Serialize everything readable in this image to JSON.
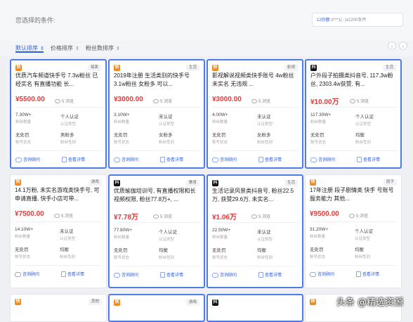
{
  "topbar": {
    "label": "您选择的条件:",
    "right_text_prefix": "12份额",
    "right_text": "d***1(··)x2200条件"
  },
  "sort": [
    {
      "label": "默认排序",
      "arrow": "⇕",
      "active": true
    },
    {
      "label": "价格排序",
      "arrow": "⇕",
      "active": false
    },
    {
      "label": "粉丝数排序",
      "arrow": "⇕",
      "active": false
    }
  ],
  "pager": {
    "prev": "‹",
    "next": "›"
  },
  "cards": [
    {
      "platform": "快",
      "tag": "搞笑",
      "title": "优质汽车频道快手号 7.3w粉丝 已经实名 有直播功能 长...",
      "price": "¥5500.00",
      "views": "5 浏览",
      "stats": [
        {
          "v": "7.30W+",
          "s": "粉丝数量"
        },
        {
          "v": "个人认证",
          "s": "认证类型"
        },
        {
          "v": "无处罚",
          "s": "账号状态"
        },
        {
          "v": "男粉多",
          "s": "粉丝性别"
        }
      ],
      "btn1": "咨询顾问",
      "btn2": "查看详情",
      "selected": true
    },
    {
      "platform": "快",
      "tag": "生活",
      "title": "2019年注册 生活类别的快手号 3.1w粉丝 女粉多 可以...",
      "price": "¥3000.00",
      "views": "5 浏览",
      "stats": [
        {
          "v": "3.10W+",
          "s": "粉丝数量"
        },
        {
          "v": "未认证",
          "s": "认证类型"
        },
        {
          "v": "无处罚",
          "s": "账号状态"
        },
        {
          "v": "女粉多",
          "s": "粉丝性别"
        }
      ],
      "btn1": "咨询顾问",
      "btn2": "查看详情",
      "selected": true
    },
    {
      "platform": "快",
      "tag": "影视",
      "title": "影视解说视频类快手账号 4w粉丝 未实名 无违规 ...",
      "price": "¥3000.00",
      "views": "5 浏览",
      "stats": [
        {
          "v": "4.00W+",
          "s": "粉丝数量"
        },
        {
          "v": "未认证",
          "s": "认证类型"
        },
        {
          "v": "无处罚",
          "s": "账号状态"
        },
        {
          "v": "女粉多",
          "s": "粉丝性别"
        }
      ],
      "btn1": "咨询顾问",
      "btn2": "查看详情",
      "selected": true
    },
    {
      "platform": "抖",
      "tag": "生活",
      "title": "户外段子拍摄类抖音号, 117.3w粉丝, 2303.4w获赞, 有...",
      "price": "¥10.00万",
      "views": "5 浏览",
      "stats": [
        {
          "v": "117.30W+",
          "s": "粉丝数量"
        },
        {
          "v": "个人认证",
          "s": "认证类型"
        },
        {
          "v": "无处罚",
          "s": "账号状态"
        },
        {
          "v": "均衡",
          "s": "粉丝性别"
        }
      ],
      "btn1": "咨询顾问",
      "btn2": "查看详情",
      "selected": true
    },
    {
      "platform": "快",
      "tag": "游戏",
      "title": "14.1万粉, 未实名游戏类快手号, 可申请直播, 快手小店可带...",
      "price": "¥7500.00",
      "views": "5 浏览",
      "stats": [
        {
          "v": "14.10W+",
          "s": "粉丝数量"
        },
        {
          "v": "未认证",
          "s": "认证类型"
        },
        {
          "v": "无处罚",
          "s": "账号状态"
        },
        {
          "v": "均衡",
          "s": "粉丝性别"
        }
      ],
      "btn1": "咨询顾问",
      "btn2": "查看详情",
      "selected": false
    },
    {
      "platform": "抖",
      "tag": "教育",
      "title": "优质瑜伽培训号, 有直播权限和长视频权限, 粉丝77.8万+, ...",
      "price": "¥7.78万",
      "views": "5 浏览",
      "stats": [
        {
          "v": "77.80W+",
          "s": "粉丝数量"
        },
        {
          "v": "个人认证",
          "s": "认证类型"
        },
        {
          "v": "无处罚",
          "s": "账号状态"
        },
        {
          "v": "均衡",
          "s": "粉丝性别"
        }
      ],
      "btn1": "咨询顾问",
      "btn2": "查看详情",
      "selected": true
    },
    {
      "platform": "抖",
      "tag": "生活",
      "title": "生活记录风景类抖音号, 粉丝22.5万, 获赞29.6万, 未实名...",
      "price": "¥1.06万",
      "views": "5 浏览",
      "stats": [
        {
          "v": "22.50W+",
          "s": "粉丝数量"
        },
        {
          "v": "未认证",
          "s": "认证类型"
        },
        {
          "v": "无处罚",
          "s": "账号状态"
        },
        {
          "v": "均衡",
          "s": "粉丝性别"
        }
      ],
      "btn1": "咨询顾问",
      "btn2": "查看详情",
      "selected": true
    },
    {
      "platform": "快",
      "tag": "段子",
      "title": "17年注册 段子剧情类 快手 号账号 服务能力 其他...",
      "price": "¥9500.00",
      "views": "5 浏览",
      "stats": [
        {
          "v": "31.20W+",
          "s": "粉丝数量"
        },
        {
          "v": "个人认证",
          "s": "认证类型"
        },
        {
          "v": "无处罚",
          "s": "账号状态"
        },
        {
          "v": "均衡",
          "s": "粉丝性别"
        }
      ],
      "btn1": "咨询顾问",
      "btn2": "查看详情",
      "selected": false
    },
    {
      "platform": "快",
      "tag": "其他",
      "selected": false
    },
    {
      "platform": "快",
      "tag": "游戏",
      "selected": true
    },
    {
      "platform": "抖",
      "tag": "",
      "selected": true
    },
    {
      "platform": "快",
      "tag": "",
      "selected": false
    }
  ],
  "watermark": "头条 @精选资源"
}
